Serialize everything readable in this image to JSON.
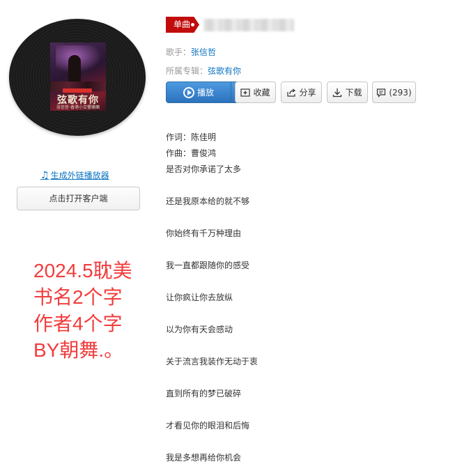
{
  "song": {
    "type_badge": "单曲",
    "artist_label": "歌手：",
    "artist": "张信哲",
    "album_label": "所属专辑：",
    "album": "弦歌有你"
  },
  "cover": {
    "top_tag": "张信哲",
    "title": "弦歌有你",
    "subtitle": "张信哲·香港小交響樂團"
  },
  "actions": {
    "play": "播放",
    "add": "+",
    "collect": "收藏",
    "share": "分享",
    "download": "下载",
    "comment": "(293)"
  },
  "left": {
    "ext_player_link": "生成外链播放器",
    "open_client": "点击打开客户端"
  },
  "watermark": [
    "2024.5耽美",
    "书名2个字",
    "作者4个字",
    "BY朝舞.。"
  ],
  "lyrics": {
    "credits": [
      "作词：陈佳明",
      "作曲：曹俊鸿"
    ],
    "lines": [
      "是否对你承诺了太多",
      "还是我原本给的就不够",
      "你始终有千万种理由",
      "我一直都跟随你的感受",
      "让你疯让你去放纵",
      "以为你有天会感动",
      "关于流言我装作无动于衷",
      "直到所有的梦已破碎",
      "才看见你的眼泪和后悔",
      "我是多想再给你机会"
    ]
  },
  "colors": {
    "badge_red": "#c20c0c",
    "link_blue": "#0c73c2",
    "play_blue": "#2c72be",
    "watermark_red": "#f23c3c"
  }
}
